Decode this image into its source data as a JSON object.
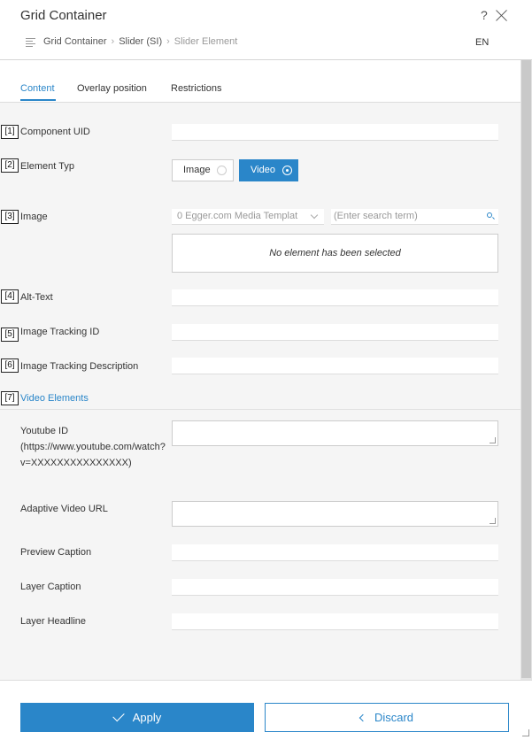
{
  "header": {
    "title": "Grid Container",
    "help_label": "?",
    "breadcrumb": [
      "Grid Container",
      "Slider (SI)",
      "Slider Element"
    ],
    "language": "EN"
  },
  "tabs": [
    "Content",
    "Overlay position",
    "Restrictions"
  ],
  "fields": {
    "component_uid": {
      "num": "[1]",
      "label": "Component UID"
    },
    "element_type": {
      "num": "[2]",
      "label": "Element Typ",
      "options": [
        "Image",
        "Video"
      ],
      "selected": "Video"
    },
    "image": {
      "num": "[3]",
      "label": "Image",
      "select_value": "0 Egger.com Media Templat",
      "search_placeholder": "(Enter search term)",
      "empty_text": "No element has been selected"
    },
    "alt_text": {
      "num": "[4]",
      "label": "Alt-Text"
    },
    "tracking_id": {
      "num": "[5]",
      "label": "Image Tracking ID"
    },
    "tracking_desc": {
      "num": "[6]",
      "label": "Image Tracking Description"
    },
    "video_elements": {
      "num": "[7]",
      "label": "Video Elements"
    }
  },
  "video": {
    "youtube_label": "Youtube ID (https://www.youtube.com/watch?v=XXXXXXXXXXXXXXX)",
    "adaptive_label": "Adaptive Video URL",
    "preview_caption": "Preview Caption",
    "layer_caption": "Layer Caption",
    "layer_headline": "Layer Headline"
  },
  "footer": {
    "apply": "Apply",
    "discard": "Discard"
  },
  "colors": {
    "accent": "#2a86c9"
  }
}
